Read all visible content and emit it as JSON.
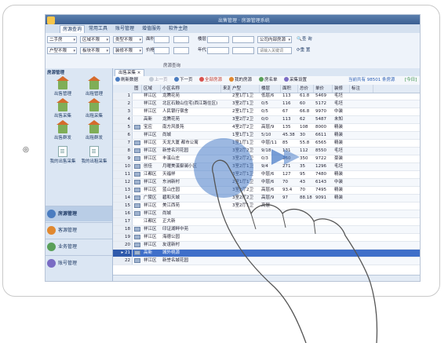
{
  "side_icons": {
    "left": "◎",
    "right_top": "⌄",
    "right_mid": "◻",
    "right_bottom": "⧉"
  },
  "window_title": "出售管理 · 房源管理系统",
  "menu": [
    "房源查询",
    "常用工具",
    "账号管理",
    "增值服务",
    "软件主题"
  ],
  "filters": {
    "row1": {
      "trade": "二手房",
      "area": "区域不限",
      "type": "类型不限",
      "area_label": "面积",
      "floor_label": "楼层",
      "source": "公司内部房源",
      "search_btn": "查 询"
    },
    "row2": {
      "usage": "户型不限",
      "block": "板块不限",
      "decor": "装修不限",
      "price_label": "价格",
      "year_label": "年代",
      "keyword_placeholder": "请输入关键词",
      "reset_btn": "重 置"
    },
    "caption": "房源查询"
  },
  "left_panel": {
    "title": "房源管理",
    "tiles": [
      "出售管理",
      "出租管理",
      "出售采集",
      "出租采集",
      "出售群发",
      "出租群发",
      "我的出售采集",
      "我的出租采集"
    ],
    "nav": [
      "房源管理",
      "客源管理",
      "业务管理",
      "账号管理"
    ]
  },
  "main": {
    "tab": "出售采集",
    "toolbar": [
      "刷新数据",
      "上一页",
      "下一页",
      "全部房源",
      "我的房源",
      "房名单",
      "采集设置"
    ],
    "summary": "当前共有 98501 条房源",
    "page_hint": "[今日]",
    "columns": [
      "图",
      "区域",
      "小区名称",
      "来源",
      "户型",
      "楼层",
      "面积",
      "总价",
      "单价",
      "装修",
      "标注"
    ],
    "rows": [
      {
        "n": "1",
        "pic": false,
        "area": "祥江区",
        "name": "龙腾花苑",
        "src": "",
        "layout": "2室1厅1卫",
        "floor": "低层/6",
        "size": "113",
        "total": "61.8",
        "unit": "5469",
        "decor": "毛坯"
      },
      {
        "n": "2",
        "pic": false,
        "area": "祥江区",
        "name": "北区石鼓山住宅(西江路住区)",
        "src": "",
        "layout": "3室2厅1卫",
        "floor": "0/5",
        "size": "116",
        "total": "60",
        "unit": "5172",
        "decor": "毛坯"
      },
      {
        "n": "3",
        "pic": false,
        "area": "祥江区",
        "name": "人民银行宿舍",
        "src": "",
        "layout": "2室1厅1卫",
        "floor": "0/5",
        "size": "67",
        "total": "66.8",
        "unit": "9970",
        "decor": "中装"
      },
      {
        "n": "4",
        "pic": false,
        "area": "高新",
        "name": "龙腾花苑",
        "src": "",
        "layout": "3室2厅2卫",
        "floor": "0/0",
        "size": "113",
        "total": "62",
        "unit": "5487",
        "decor": "未知"
      },
      {
        "n": "5",
        "pic": true,
        "area": "宝应",
        "name": "南方风景苑",
        "src": "",
        "layout": "4室2厅2卫",
        "floor": "高层/9",
        "size": "135",
        "total": "108",
        "unit": "8000",
        "decor": "精装"
      },
      {
        "n": "6",
        "pic": false,
        "area": "祥江区",
        "name": "尚城",
        "src": "",
        "layout": "1室1厅1卫",
        "floor": "5/10",
        "size": "45.38",
        "total": "30",
        "unit": "6611",
        "decor": "精装"
      },
      {
        "n": "7",
        "pic": true,
        "area": "祥江区",
        "name": "天龙大厦 都市公寓",
        "src": "",
        "layout": "1室1厅1卫",
        "floor": "中层/11",
        "size": "85",
        "total": "55.8",
        "unit": "6565",
        "decor": "精装"
      },
      {
        "n": "8",
        "pic": true,
        "area": "祥江区",
        "name": "新誉名河花园",
        "src": "",
        "layout": "3室2厅2卫",
        "floor": "9/18",
        "size": "131",
        "total": "112",
        "unit": "8550",
        "decor": "毛坯"
      },
      {
        "n": "9",
        "pic": true,
        "area": "祥江区",
        "name": "丰溪山庄",
        "src": "",
        "layout": "3室2厅2卫",
        "floor": "0/3",
        "size": "360",
        "total": "350",
        "unit": "9722",
        "decor": "豪装"
      },
      {
        "n": "10",
        "pic": true,
        "area": "创佳",
        "name": "月曜美溪御澜小区",
        "src": "",
        "layout": "3室2厅1卫",
        "floor": "9/4",
        "size": "271",
        "total": "35",
        "unit": "1296",
        "decor": "毛坯"
      },
      {
        "n": "11",
        "pic": true,
        "area": "江都区",
        "name": "天福祥",
        "src": "",
        "layout": "3室2厅1卫",
        "floor": "中层/6",
        "size": "127",
        "total": "95",
        "unit": "7480",
        "decor": "精装"
      },
      {
        "n": "12",
        "pic": true,
        "area": "祥江区",
        "name": "东洲新村",
        "src": "",
        "layout": "2室1厅1卫",
        "floor": "中层/6",
        "size": "70",
        "total": "43",
        "unit": "6143",
        "decor": "中装"
      },
      {
        "n": "13",
        "pic": true,
        "area": "祥江区",
        "name": "蓝山庄园",
        "src": "",
        "layout": "3室2厅2卫",
        "floor": "高层/6",
        "size": "93.4",
        "total": "70",
        "unit": "7495",
        "decor": "精装"
      },
      {
        "n": "14",
        "pic": true,
        "area": "广陵区",
        "name": "碧和天城",
        "src": "",
        "layout": "3室2厅2卫",
        "floor": "高层/9",
        "size": "97",
        "total": "88.18",
        "unit": "9091",
        "decor": "精装"
      },
      {
        "n": "15",
        "pic": true,
        "area": "祥江区",
        "name": "美江西苑",
        "src": "",
        "layout": "3室2厅1卫",
        "floor": "高层",
        "size": "",
        "total": "",
        "unit": "",
        "decor": ""
      },
      {
        "n": "16",
        "pic": true,
        "area": "祥江区",
        "name": "尚城",
        "src": "",
        "layout": "",
        "floor": "",
        "size": "",
        "total": "",
        "unit": "",
        "decor": ""
      },
      {
        "n": "17",
        "pic": false,
        "area": "江都区",
        "name": "正大新",
        "src": "",
        "layout": "",
        "floor": "",
        "size": "",
        "total": "",
        "unit": "",
        "decor": ""
      },
      {
        "n": "18",
        "pic": true,
        "area": "祥江区",
        "name": "印证湖畔中苑",
        "src": "",
        "layout": "",
        "floor": "",
        "size": "",
        "total": "",
        "unit": "",
        "decor": ""
      },
      {
        "n": "19",
        "pic": true,
        "area": "祥江区",
        "name": "海德公园",
        "src": "",
        "layout": "",
        "floor": "",
        "size": "",
        "total": "",
        "unit": "",
        "decor": ""
      },
      {
        "n": "20",
        "pic": true,
        "area": "祥江区",
        "name": "友谊新村",
        "src": "",
        "layout": "",
        "floor": "",
        "size": "",
        "total": "",
        "unit": "",
        "decor": ""
      },
      {
        "n": "21",
        "pic": true,
        "area": "高新",
        "name": "城外桃源",
        "src": "",
        "layout": "",
        "floor": "",
        "size": "",
        "total": "",
        "unit": "",
        "decor": ""
      },
      {
        "n": "22",
        "pic": true,
        "area": "祥江区",
        "name": "新誉名城花园",
        "src": "",
        "layout": "",
        "floor": "",
        "size": "",
        "total": "",
        "unit": "",
        "decor": ""
      }
    ],
    "selected_row": "21"
  },
  "colors": {
    "accent": "#3f6fc9",
    "titlebar": "#3b5f91",
    "panel": "#dbe6f3",
    "gesture": "#4b7dc8"
  }
}
